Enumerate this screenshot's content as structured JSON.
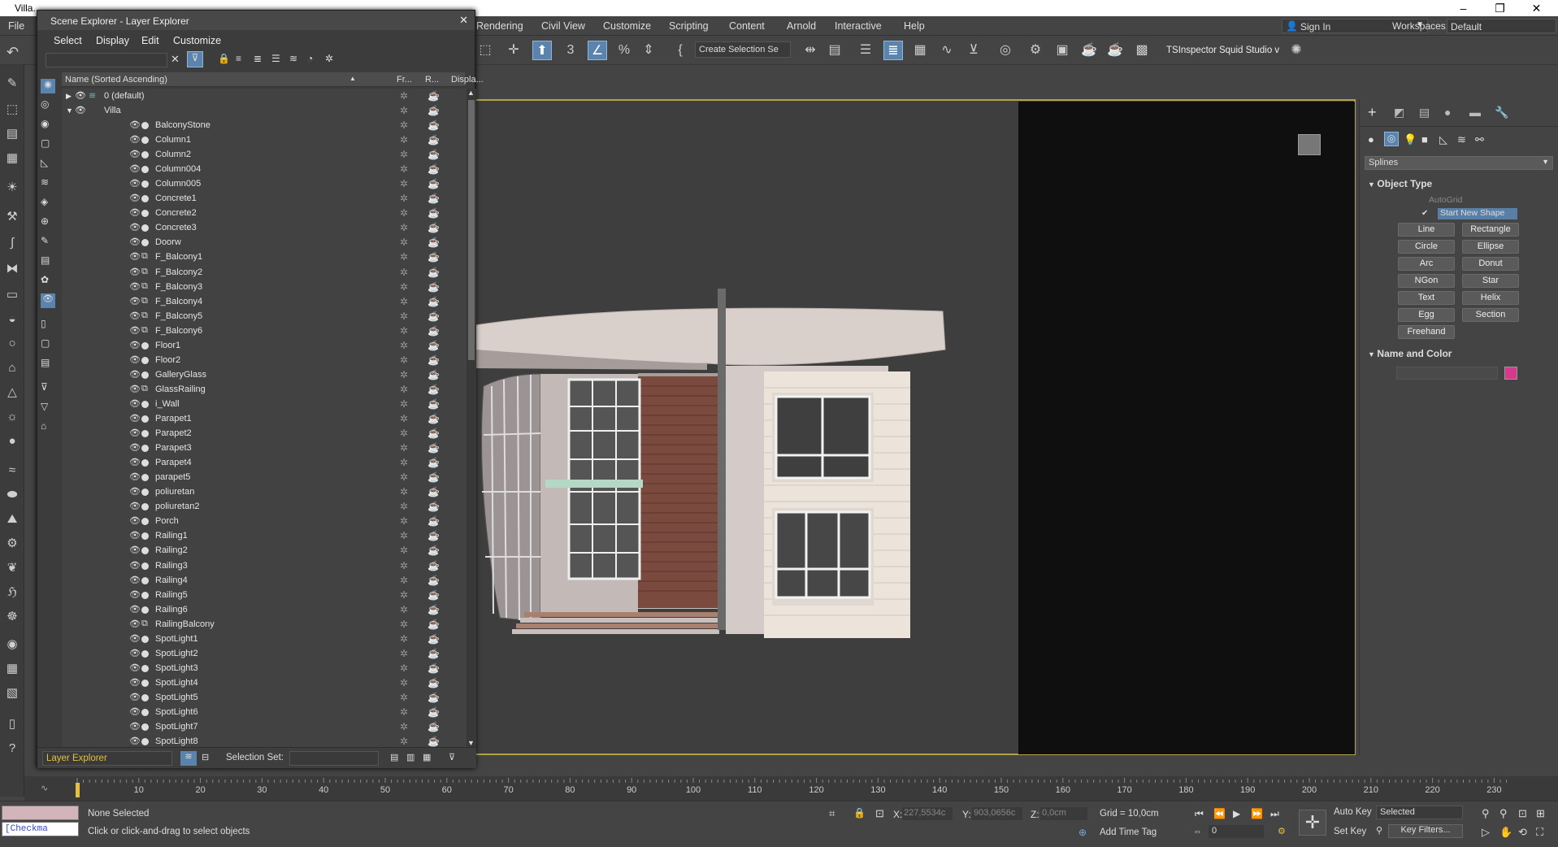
{
  "window": {
    "title": "Villa."
  },
  "menu": [
    "File",
    "Rendering",
    "Civil View",
    "Customize",
    "Scripting",
    "Content",
    "Arnold",
    "Interactive",
    "Help"
  ],
  "signin": "Sign In",
  "workspaces_label": "Workspaces:",
  "workspace_value": "Default",
  "selection_set_dropdown": "Create Selection Se",
  "tsinspector": "TSInspector",
  "squid": "Squid Studio v",
  "scene_explorer": {
    "title": "Scene Explorer - Layer Explorer",
    "menu": [
      "Select",
      "Display",
      "Edit",
      "Customize"
    ],
    "columns": [
      "Name (Sorted Ascending)",
      "Fr...",
      "R...",
      "Displa..."
    ],
    "layers": [
      "0 (default)",
      "Villa"
    ],
    "items": [
      "BalconyStone",
      "Column1",
      "Column2",
      "Column004",
      "Column005",
      "Concrete1",
      "Concrete2",
      "Concrete3",
      "Doorw",
      "F_Balcony1",
      "F_Balcony2",
      "F_Balcony3",
      "F_Balcony4",
      "F_Balcony5",
      "F_Balcony6",
      "Floor1",
      "Floor2",
      "GalleryGlass",
      "GlassRailing",
      "i_Wall",
      "Parapet1",
      "Parapet2",
      "Parapet3",
      "Parapet4",
      "parapet5",
      "poliuretan",
      "poliuretan2",
      "Porch",
      "Railing1",
      "Railing2",
      "Railing3",
      "Railing4",
      "Railing5",
      "Railing6",
      "RailingBalcony",
      "SpotLight1",
      "SpotLight2",
      "SpotLight3",
      "SpotLight4",
      "SpotLight5",
      "SpotLight6",
      "SpotLight7",
      "SpotLight8"
    ],
    "group_icon_items": [
      "F_Balcony1",
      "F_Balcony2",
      "F_Balcony3",
      "F_Balcony4",
      "F_Balcony5",
      "F_Balcony6",
      "GlassRailing",
      "RailingBalcony"
    ],
    "footer_explorer": "Layer Explorer",
    "footer_selection_label": "Selection Set:"
  },
  "command_panel": {
    "category": "Splines",
    "rollout_object_type": "Object Type",
    "autogrid": "AutoGrid",
    "start_new_shape": "Start New Shape",
    "buttons": [
      "Line",
      "Rectangle",
      "Circle",
      "Ellipse",
      "Arc",
      "Donut",
      "NGon",
      "Star",
      "Text",
      "Helix",
      "Egg",
      "Section",
      "Freehand"
    ],
    "rollout_name_color": "Name and Color",
    "color": "#d43a8c"
  },
  "timeline": {
    "ticks": [
      "10",
      "20",
      "30",
      "40",
      "50",
      "60",
      "70",
      "80",
      "90",
      "100",
      "110",
      "120",
      "130",
      "140",
      "150",
      "160",
      "170",
      "180",
      "190",
      "200",
      "210",
      "220",
      "230"
    ]
  },
  "status": {
    "selected": "None Selected",
    "prompt": "Click or click-and-drag to select objects",
    "maxscript": "[Checkma",
    "x_label": "X:",
    "x_val": "227,5534c",
    "y_label": "Y:",
    "y_val": "903,0656c",
    "z_label": "Z:",
    "z_val": "0,0cm",
    "grid": "Grid = 10,0cm",
    "add_time_tag": "Add Time Tag",
    "auto_key": "Auto Key",
    "set_key": "Set Key",
    "selected_dd": "Selected",
    "key_filters": "Key Filters...",
    "frame": "0"
  }
}
